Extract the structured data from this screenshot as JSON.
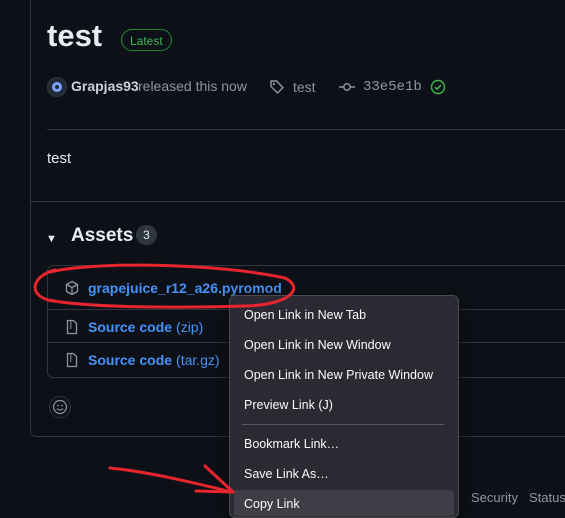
{
  "release": {
    "title": "test",
    "badge": "Latest",
    "author": "Grapjas93",
    "released_text": "released this now",
    "tag": "test",
    "commit": "33e5e1b",
    "body": "test"
  },
  "assets": {
    "title": "Assets",
    "count": "3",
    "items": [
      {
        "name": "grapejuice_r12_a26.pyromod",
        "ext": ""
      },
      {
        "name": "Source code",
        "ext": "(zip)"
      },
      {
        "name": "Source code",
        "ext": "(tar.gz)"
      }
    ]
  },
  "footer": {
    "links": [
      "Security",
      "Status"
    ]
  },
  "context_menu": {
    "items": [
      "Open Link in New Tab",
      "Open Link in New Window",
      "Open Link in New Private Window",
      "Preview Link (J)",
      "Bookmark Link…",
      "Save Link As…",
      "Copy Link"
    ]
  },
  "colors": {
    "background": "#0d1117",
    "link": "#4493f8",
    "annotation": "#e8242c",
    "menu_bg": "#2b2a33",
    "badge_green": "#3fb950"
  }
}
